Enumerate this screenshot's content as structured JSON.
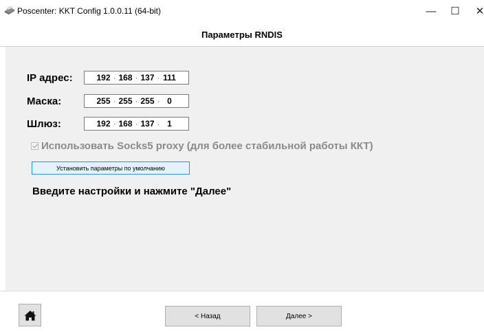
{
  "window": {
    "title": "Poscenter: KKT Config 1.0.0.11 (64-bit)",
    "controls": {
      "minimize": "—",
      "maximize": "☐",
      "close": "✕"
    }
  },
  "header": {
    "title": "Параметры RNDIS"
  },
  "form": {
    "ip": {
      "label": "IP адрес:",
      "octets": [
        "192",
        "168",
        "137",
        "111"
      ]
    },
    "mask": {
      "label": "Маска:",
      "octets": [
        "255",
        "255",
        "255",
        "0"
      ]
    },
    "gateway": {
      "label": "Шлюз:",
      "octets": [
        "192",
        "168",
        "137",
        "1"
      ]
    },
    "separator": "·",
    "socks_checkbox": {
      "label": "Использовать Socks5 proxy (для более стабильной работы ККТ)",
      "checked": true,
      "enabled": false
    },
    "default_button": "Установить параметры по умолчанию",
    "instruction": "Введите настройки и нажмите \"Далее\""
  },
  "footer": {
    "home_icon": "home-icon",
    "back_label": "< Назад",
    "next_label": "Далее >"
  },
  "colors": {
    "content_bg": "#f0f0f0",
    "button_focus_border": "#1e90ff"
  }
}
